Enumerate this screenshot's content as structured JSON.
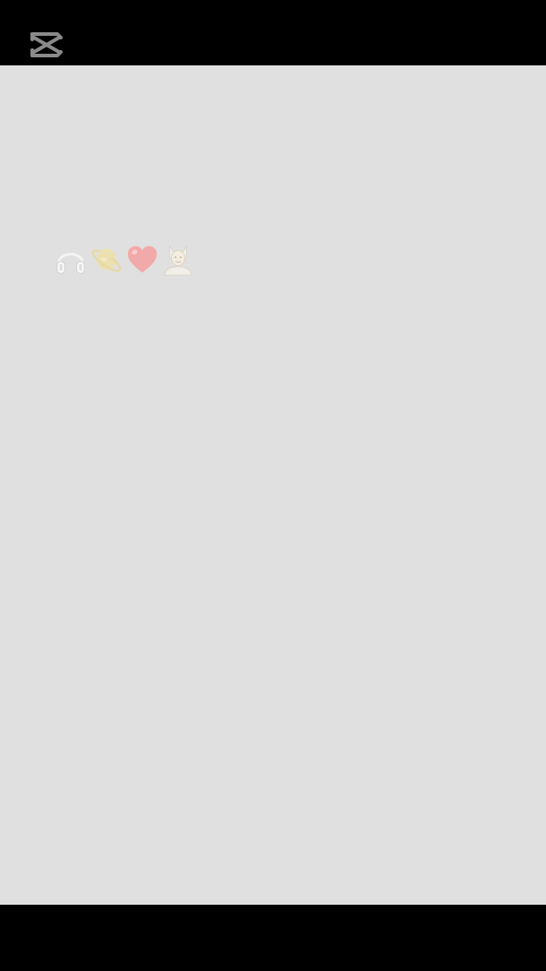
{
  "app": {
    "logo_icon": "capcut-logo-icon"
  },
  "canvas": {
    "background": "#e0e0e0"
  },
  "overlay": {
    "emojis": [
      "headphones-icon",
      "ringed-planet-icon",
      "red-heart-icon",
      "mage-icon"
    ]
  }
}
